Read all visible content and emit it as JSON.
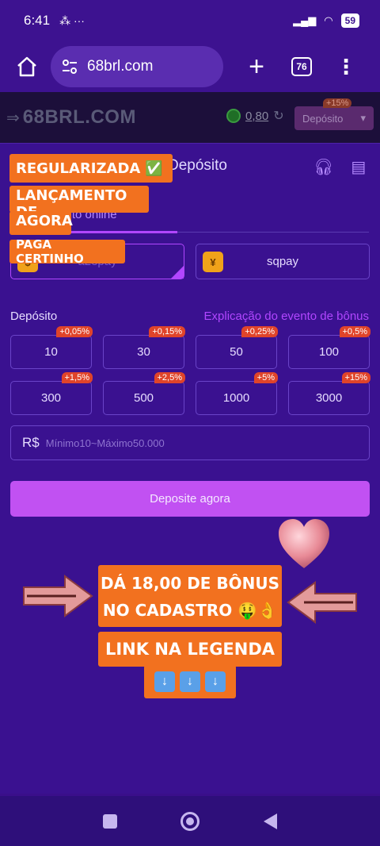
{
  "status": {
    "time": "6:41",
    "icons": "⁂ ···",
    "battery": "59"
  },
  "browser": {
    "url": "68brl.com",
    "tabs_count": "76"
  },
  "site": {
    "logo": "68BRL.COM",
    "balance": "0,80",
    "deposit_button": "Depósito",
    "deposit_badge": "+15%"
  },
  "modal": {
    "title": "Depósito",
    "tab_online": "sito online",
    "payments": [
      {
        "label": "a2epay",
        "selected": true
      },
      {
        "label": "sqpay",
        "selected": false
      }
    ],
    "deposit_label": "Depósito",
    "bonus_link": "Explicação do evento de bônus",
    "amounts": [
      {
        "value": "10",
        "bonus": "+0,05%"
      },
      {
        "value": "30",
        "bonus": "+0,15%"
      },
      {
        "value": "50",
        "bonus": "+0,25%"
      },
      {
        "value": "100",
        "bonus": "+0,5%"
      },
      {
        "value": "300",
        "bonus": "+1,5%"
      },
      {
        "value": "500",
        "bonus": "+2,5%"
      },
      {
        "value": "1000",
        "bonus": "+5%"
      },
      {
        "value": "3000",
        "bonus": "+15%"
      }
    ],
    "currency": "R$",
    "amount_placeholder": "Mínimo10~Máximo50.000",
    "submit": "Deposite agora"
  },
  "overlay": {
    "sticker1": "REGULARIZADA",
    "sticker2a": "LANÇAMENTO DE",
    "sticker2b": "AGORA",
    "sticker3": "PAGA CERTINHO",
    "bonus_line1": "DÁ 18,00 DE BÔNUS",
    "bonus_line2": "NO CADASTRO 🤑👌",
    "link": "LINK NA LEGENDA"
  },
  "colors": {
    "accent": "#b146ff",
    "orange": "#f2711f",
    "background": "#3a1190"
  }
}
